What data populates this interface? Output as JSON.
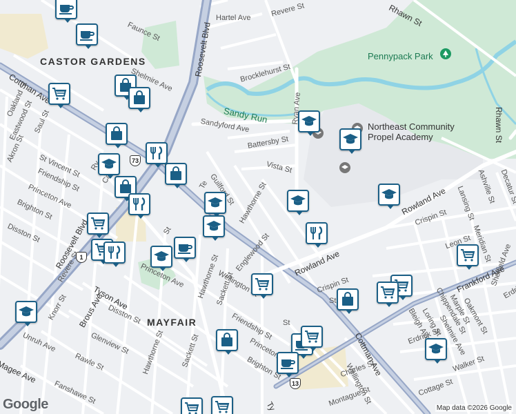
{
  "map": {
    "colors": {
      "background": "#eef0f3",
      "park": "#cfe9d6",
      "water": "#8fd3e5",
      "road": "#ffffff",
      "major_road": "#97a7c7",
      "pin_border": "#1b5f86"
    },
    "area_labels": {
      "castor_gardens": "CASTOR GARDENS",
      "mayfair": "MAYFAIR"
    },
    "park_labels": {
      "pennypack": "Pennypack Park",
      "sandy_run": "Sandy Run"
    },
    "school_labels": {
      "northeast_community": "Northeast Community\nPropel Academy"
    },
    "street_labels": {
      "faunce_st": "Faunce St",
      "hartel_ave": "Hartel Ave",
      "revere_st": "Revere St",
      "rhawn_st_top": "Rhawn St",
      "brocklehurst_st": "Brocklehurst St",
      "shelmire_ave": "Shelmire Ave",
      "roosevelt_blvd": "Roosevelt Blvd",
      "cottman_ave_left": "Cottman Ave",
      "sandyford_ave": "Sandyford Ave",
      "ryan_ave": "Ryan Ave",
      "oakland_st": "Oakland St",
      "eastwood_st": "Eastwood St",
      "saul_st": "Saul St",
      "akron_st": "Akron St",
      "st_vincent_st": "St Vincent St",
      "friendship_st_left": "Friendship St",
      "princeton_ave_left": "Princeton Ave",
      "brighton_st_left": "Brighton St",
      "disston_st_left": "Disston St",
      "battersby_st": "Battersby St",
      "vista_st": "Vista St",
      "guilford_st": "Guilford St",
      "hawthorne_st_1": "Hawthorne St",
      "rowland_ave_right": "Rowland Ave",
      "rowland_ave_mid": "Rowland Ave",
      "crispin_st": "Crispin St",
      "lansing_st": "Lansing St",
      "ashville_st": "Ashville St",
      "decatur_st": "Decatur St",
      "rhawn_st_right": "Rhawn St",
      "leon_st": "Leon St",
      "meridian_st": "Meridian St",
      "frankford_ave": "Frankford Ave",
      "sheffield_ave": "Sheffield Ave",
      "erdrick_st": "Erdrick St",
      "tyson_ave": "Tyson Ave",
      "brous_ave": "Brous Ave",
      "princeton_ave_mid": "Princeton Ave",
      "hawthorne_st_2": "Hawthorne St",
      "englewood_st": "Englewood St",
      "wellington_st": "Wellington St",
      "sackett_st": "Sackett St",
      "friendship_st_mid": "Friendship St",
      "disston_st_mid": "Disston St",
      "glenview_st": "Glenview St",
      "knorr_st": "Knorr St",
      "revere_st_bottom": "Revere St",
      "unruh_ave": "Unruh Ave",
      "rawle_st": "Rawle St",
      "magee_ave": "Magee Ave",
      "fanshawe_st": "Fanshawe St",
      "princeton_ave_bottom": "Princeton Ave",
      "brighton_st_bottom": "Brighton St",
      "cottman_ave_right": "Cottman Ave",
      "wellington_st_bottom": "Wellington St",
      "charles_st": "Charles St",
      "montague_st": "Montague St",
      "chippendale_st": "Chippendale St",
      "marple_st": "Marple St",
      "oakmont_st": "Oakmont St",
      "shelmire_ave_right": "Shelmire Ave",
      "bleigh_ave": "Bleigh Ave",
      "loring_st": "Loring St",
      "walker_st": "Walker St",
      "cottage_st": "Cottage St",
      "ty": "Ty",
      "roosevelt_blvd_left": "Roosevelt Blvd",
      "ry": "Ry",
      "te": "Te",
      "ca": "Ca",
      "st": "St",
      "st2": "St",
      "crispin_st_bottom": "Crispin St",
      "sackett_st_bottom": "Sackett St",
      "hawthorne_st_3": "Hawthorne St",
      "st3": "St"
    },
    "route_shields": {
      "r73": "73",
      "r1": "1",
      "r13": "13"
    },
    "copyright": "Map data ©2026 Google",
    "logo": "Google"
  }
}
